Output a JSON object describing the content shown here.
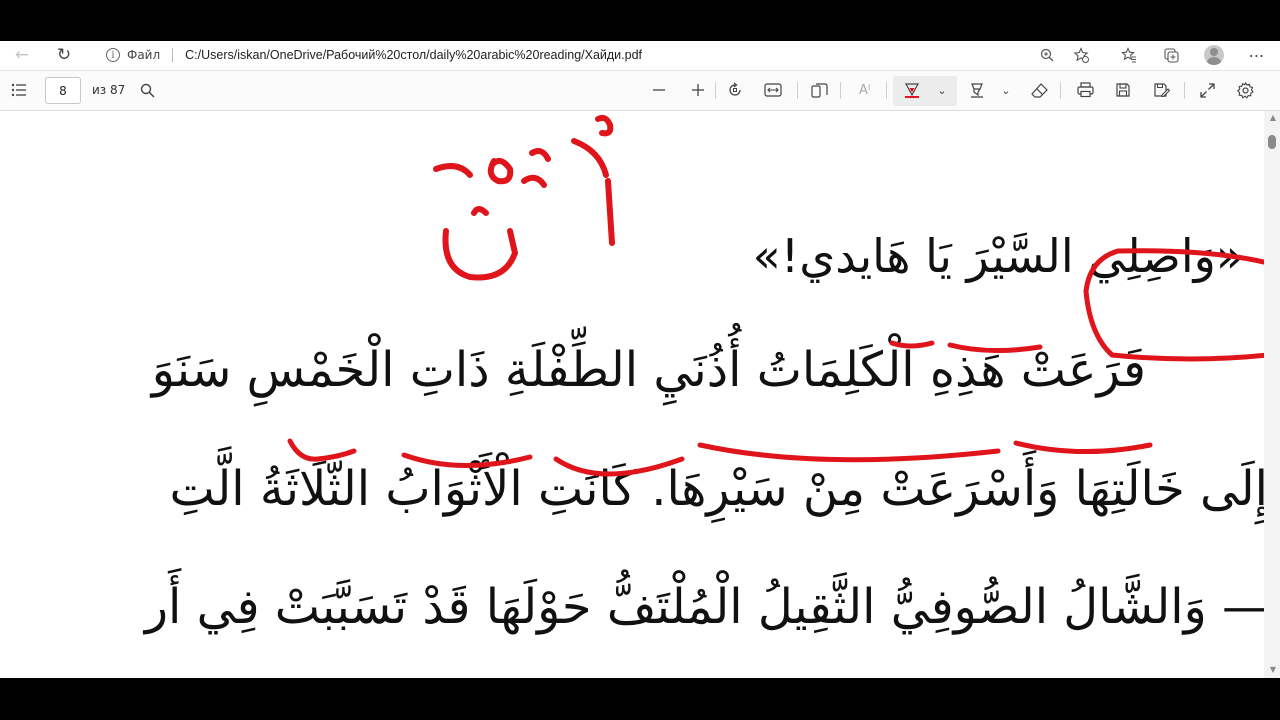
{
  "address_bar": {
    "site_label": "Файл",
    "url": "C:/Users/iskan/OneDrive/Рабочий%20стол/daily%20arabic%20reading/Хайди.pdf"
  },
  "pdf_toolbar": {
    "page_number": "8",
    "page_total": "из 87"
  },
  "document": {
    "handwritten_note": "أُذُنٌ",
    "lines": [
      "«وَاصِلِي السَّيْرَ يَا هَايدي!»",
      "قَرَعَتْ هَذِهِ الْكَلِمَاتُ أُذُنَيِ الطِّفْلَةِ ذَاتِ الْخَمْسِ سَنَوَ",
      "إِلَى خَالَتِهَا وَأَسْرَعَتْ مِنْ سَيْرِهَا. كَانَتِ الْأَثْوَابُ الثَّلَاثَةُ الَّتِ",
      "— وَالشَّالُ الصُّوفِيُّ الثَّقِيلُ الْمُلْتَفُّ حَوْلَهَا قَدْ تَسَبَّبَتْ فِي أَر"
    ],
    "ink_color": "#e0141b"
  }
}
